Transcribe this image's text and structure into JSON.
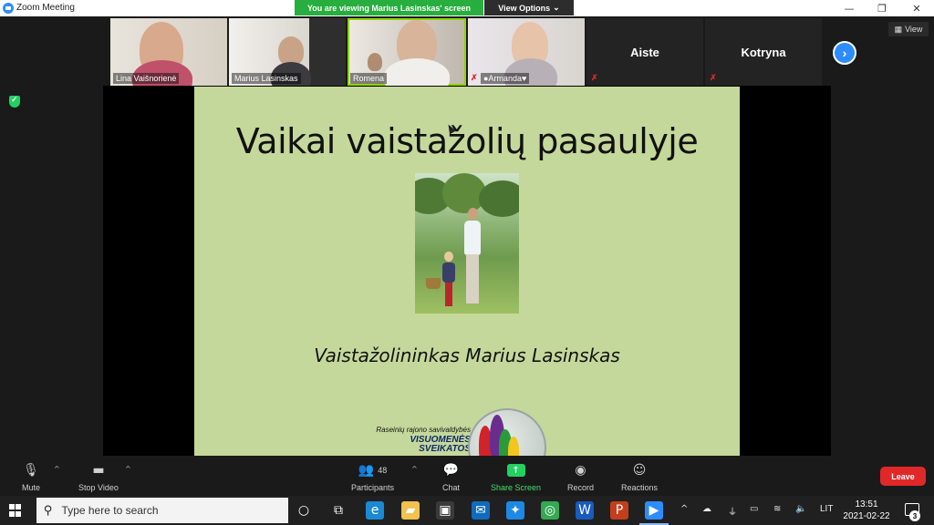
{
  "window": {
    "title": "Zoom Meeting",
    "minimize_glyph": "—",
    "restore_glyph": "❐",
    "close_glyph": "✕"
  },
  "banner": {
    "text": "You are viewing Marius Lasinskas' screen",
    "view_options_label": "View Options",
    "view_options_caret": "⌄"
  },
  "participants_strip": {
    "video_tiles": [
      {
        "name": "Lina Vaišnorienė",
        "speaking": false
      },
      {
        "name": "Marius Lasinskas",
        "speaking": false
      },
      {
        "name": "Romena",
        "speaking": true
      },
      {
        "name": "●Armanda♥",
        "speaking": false
      }
    ],
    "name_tiles": [
      {
        "name": "Aiste",
        "muted": true
      },
      {
        "name": "Kotryna",
        "muted": true
      }
    ],
    "next_glyph": "›",
    "view_label": "View",
    "view_glyph": "▦",
    "mute_glyph": "✗"
  },
  "slide": {
    "title": "Vaikai vaistažolių pasaulyje",
    "subtitle": "Vaistažolininkas Marius Lasinskas",
    "logo_line1": "Raseinių rajono savivaldybės",
    "logo_line2": "VISUOMENĖS",
    "logo_line3": "SVEIKATOS"
  },
  "toolbar": {
    "mute_label": "Mute",
    "mute_glyph": "🎙",
    "stop_video_label": "Stop Video",
    "video_glyph": "▬",
    "caret_glyph": "^",
    "participants_label": "Participants",
    "participants_glyph": "👥",
    "participants_count": "48",
    "chat_label": "Chat",
    "chat_glyph": "💬",
    "share_screen_label": "Share Screen",
    "share_glyph": "↑",
    "record_label": "Record",
    "record_glyph": "◉",
    "reactions_label": "Reactions",
    "reactions_glyph": "☺",
    "leave_label": "Leave"
  },
  "taskbar": {
    "search_placeholder": "Type here to search",
    "search_glyph": "⚲",
    "task_view_glyph": "○",
    "apps": [
      {
        "name": "task-view",
        "glyph": "⧉",
        "color": "#202020"
      },
      {
        "name": "edge",
        "glyph": "e",
        "color": "#1a8ad4"
      },
      {
        "name": "file-explorer",
        "glyph": "▰",
        "color": "#f2c14e"
      },
      {
        "name": "store",
        "glyph": "▣",
        "color": "#3a3a3a"
      },
      {
        "name": "mail",
        "glyph": "✉",
        "color": "#0f6cbd"
      },
      {
        "name": "safari",
        "glyph": "✦",
        "color": "#1e88e5"
      },
      {
        "name": "chrome",
        "glyph": "◎",
        "color": "#34a853"
      },
      {
        "name": "word",
        "glyph": "W",
        "color": "#185abd"
      },
      {
        "name": "powerpoint",
        "glyph": "P",
        "color": "#c43e1c"
      },
      {
        "name": "zoom",
        "glyph": "▶",
        "color": "#2d8cff"
      }
    ],
    "tray_up": "^",
    "tray_cloud": "☁",
    "tray_usb": "⏚",
    "tray_battery": "▭",
    "tray_wifi": "≋",
    "tray_volume": "🔈",
    "language": "LIT",
    "time": "13:51",
    "date": "2021-02-22",
    "notification_count": "3"
  }
}
